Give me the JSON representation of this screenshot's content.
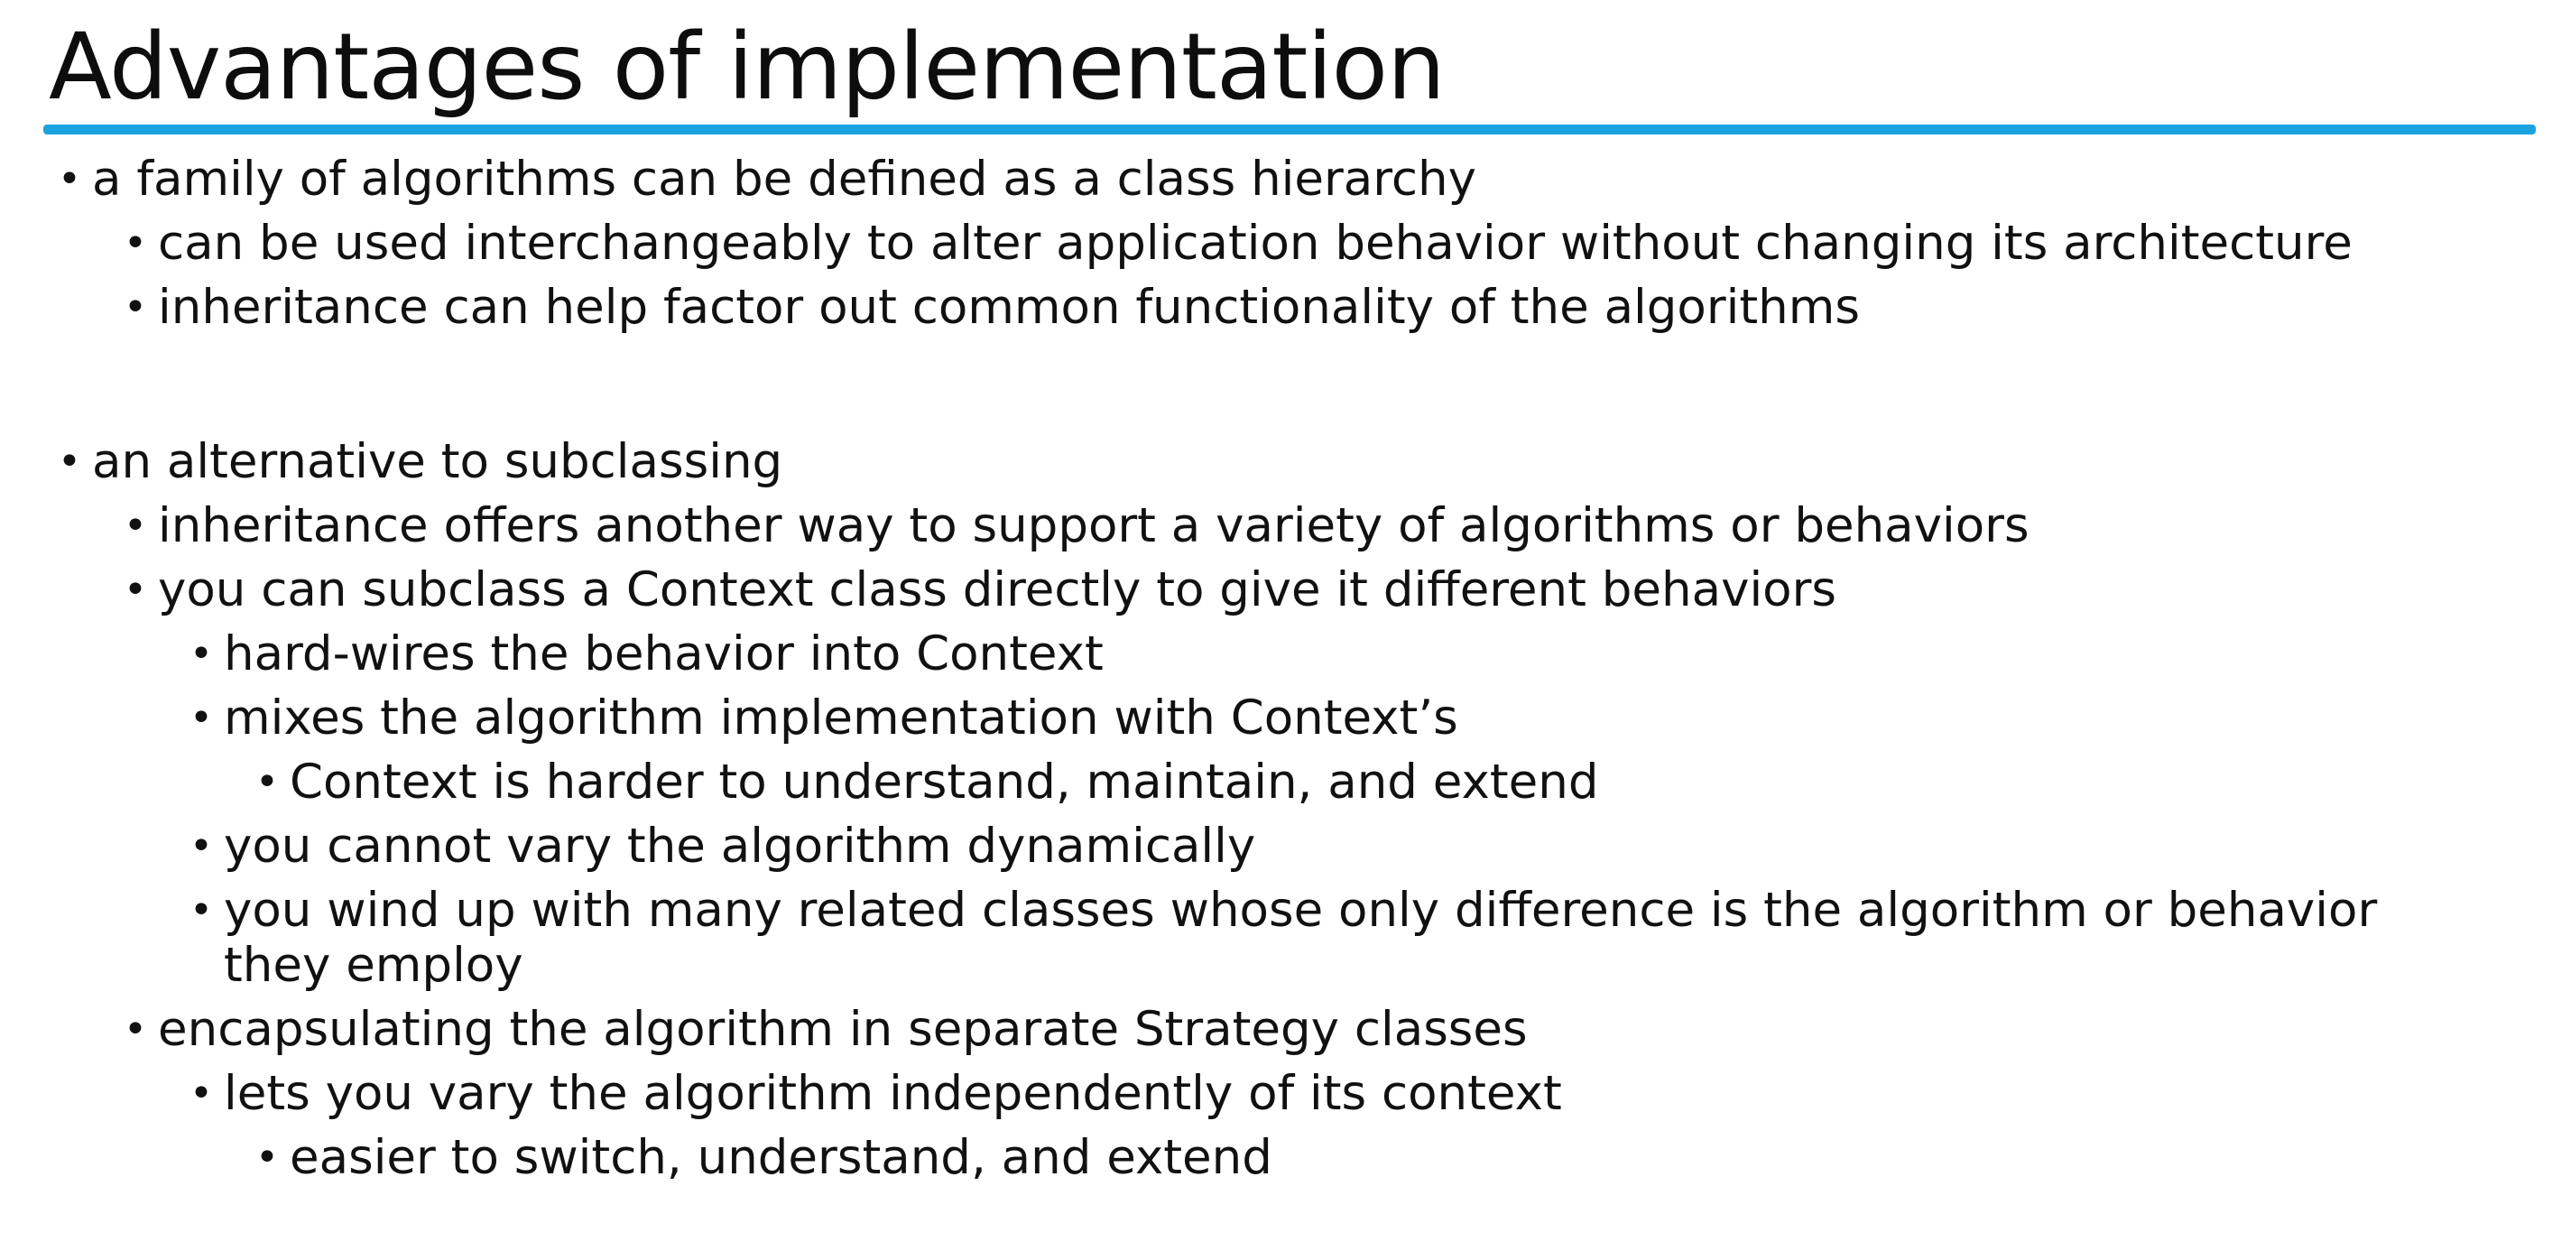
{
  "slide": {
    "title": "Advantages of implementation",
    "accent_color": "#1aa3df",
    "bullet_glyph": "•",
    "sections": [
      {
        "items": [
          {
            "level": 0,
            "text": "a family of algorithms can be defined as a class hierarchy"
          },
          {
            "level": 1,
            "text": "can be used interchangeably to alter application behavior without changing its architecture"
          },
          {
            "level": 1,
            "text": "inheritance can help factor out common functionality of the algorithms"
          }
        ]
      },
      {
        "items": [
          {
            "level": 0,
            "text": "an alternative to subclassing"
          },
          {
            "level": 1,
            "text": "inheritance offers another way to support a variety of algorithms or behaviors"
          },
          {
            "level": 1,
            "text": "you can subclass a Context class directly to give it different behaviors"
          },
          {
            "level": 2,
            "text": "hard-wires the behavior into Context"
          },
          {
            "level": 2,
            "text": "mixes the algorithm implementation with Context’s"
          },
          {
            "level": 3,
            "text": "Context is harder to understand, maintain, and extend"
          },
          {
            "level": 2,
            "text": "you cannot vary the algorithm dynamically"
          },
          {
            "level": 2,
            "text": "you wind up with many related classes whose only difference is the algorithm or behavior they employ"
          },
          {
            "level": 1,
            "text": "encapsulating the algorithm in separate Strategy classes"
          },
          {
            "level": 2,
            "text": "lets you vary the algorithm independently of its context"
          },
          {
            "level": 3,
            "text": "easier to switch, understand, and extend"
          }
        ]
      }
    ]
  }
}
